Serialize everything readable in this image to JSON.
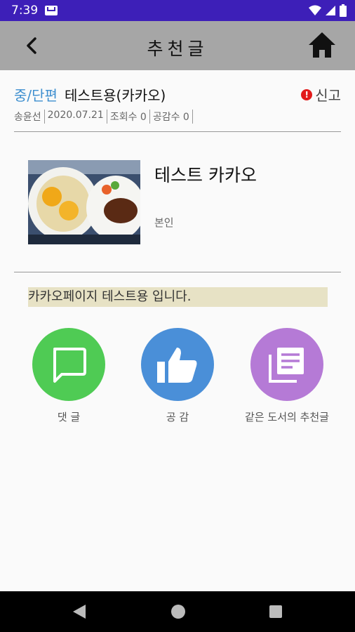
{
  "status_bar": {
    "time": "7:39"
  },
  "app_bar": {
    "title": "추천글"
  },
  "header": {
    "genre": "중/단편",
    "book_title": "테스트용(카카오)",
    "report_label": "신고",
    "author": "송윤선",
    "date": "2020.07.21",
    "views": "조회수 0",
    "likes": "공감수 0"
  },
  "book": {
    "title": "테스트 카카오",
    "author": "본인"
  },
  "content": {
    "text": "카카오페이지 테스트용 입니다."
  },
  "actions": [
    {
      "label": "댓 글",
      "color": "#4fcb54"
    },
    {
      "label": "공 감",
      "color": "#4a8fd8"
    },
    {
      "label": "같은 도서의 추천글",
      "color": "#b57ad6"
    }
  ]
}
